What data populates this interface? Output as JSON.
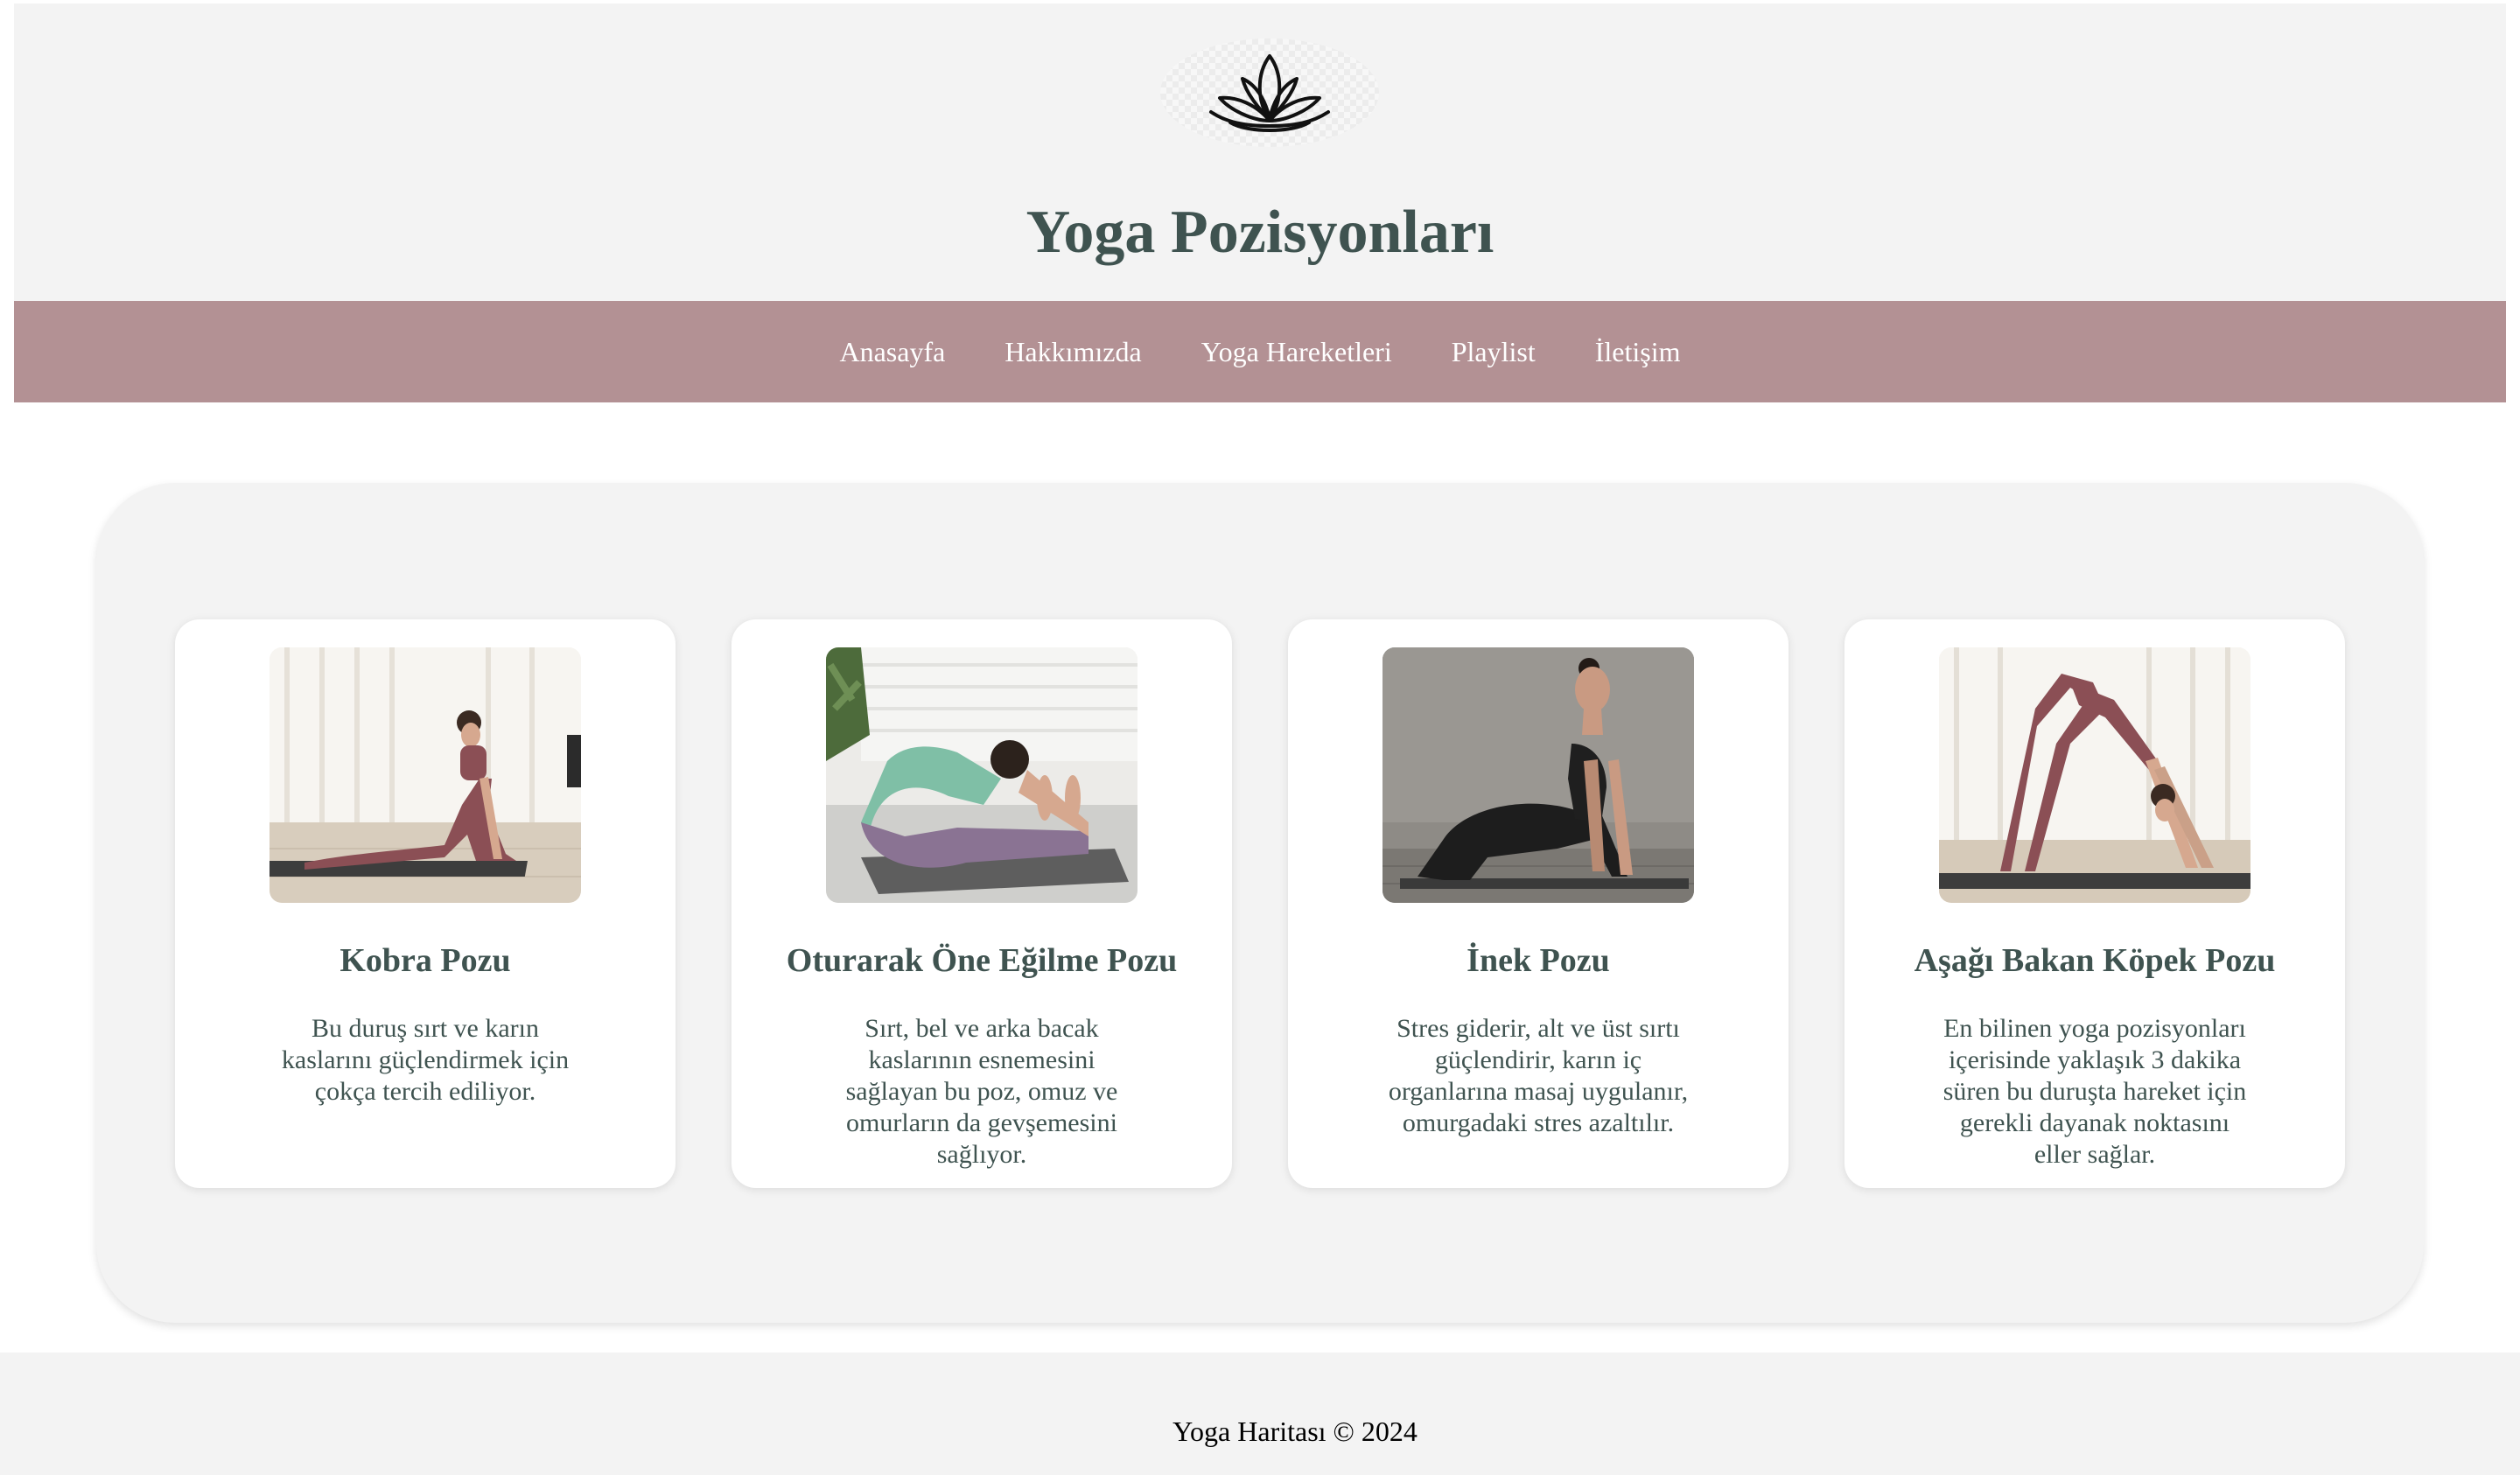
{
  "header": {
    "logo_icon": "lotus-icon",
    "title": "Yoga Pozisyonları"
  },
  "nav": {
    "items": [
      {
        "label": "Anasayfa"
      },
      {
        "label": "Hakkımızda"
      },
      {
        "label": "Yoga Hareketleri"
      },
      {
        "label": "Playlist"
      },
      {
        "label": "İletişim"
      }
    ]
  },
  "cards": [
    {
      "title": "Kobra Pozu",
      "text": "Bu duruş sırt ve karın kaslarını güçlendirmek için çokça tercih ediliyor.",
      "image": "cobra-pose-photo"
    },
    {
      "title": "Oturarak Öne Eğilme Pozu",
      "text": "Sırt, bel ve arka bacak kaslarının esnemesini sağlayan bu poz, omuz ve omurların da gevşemesini sağlıyor.",
      "image": "seated-forward-bend-photo"
    },
    {
      "title": "İnek Pozu",
      "text": "Stres giderir, alt ve üst sırtı güçlendirir, karın iç organlarına masaj uygulanır, omurgadaki stres azaltılır.",
      "image": "cow-pose-photo"
    },
    {
      "title": "Aşağı Bakan Köpek Pozu",
      "text": "En bilinen yoga pozisyonları içerisinde yaklaşık 3 dakika süren bu duruşta hareket için gerekli dayanak noktasını eller sağlar.",
      "image": "downward-dog-photo"
    }
  ],
  "footer": {
    "text": "Yoga Haritası © 2024"
  },
  "colors": {
    "nav_background": "#b39194",
    "title_color": "#3f5350",
    "panel_background": "#f3f3f3"
  }
}
